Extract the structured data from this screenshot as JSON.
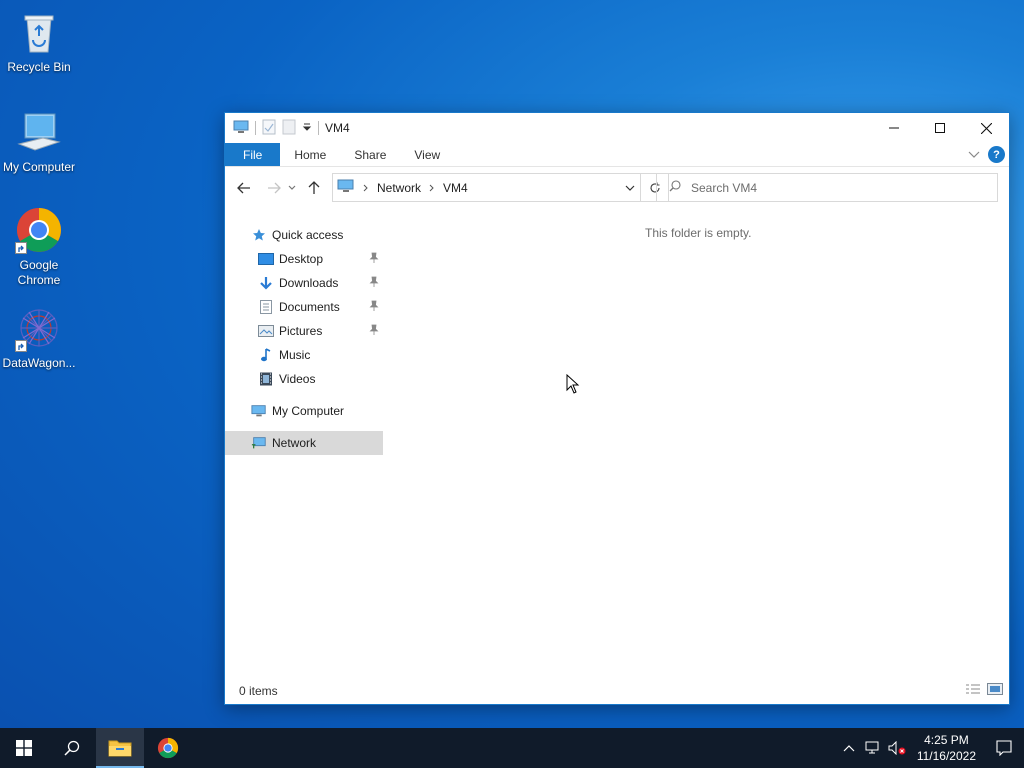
{
  "desktop": {
    "icons": [
      {
        "label": "Recycle Bin",
        "icon": "recycle-bin-icon"
      },
      {
        "label": "My Computer",
        "icon": "computer-icon"
      },
      {
        "label": "Google Chrome",
        "icon": "chrome-icon"
      },
      {
        "label": "DataWagon...",
        "icon": "datawagon-icon"
      }
    ]
  },
  "window": {
    "title": "VM4",
    "tabs": {
      "file": "File",
      "home": "Home",
      "share": "Share",
      "view": "View"
    },
    "help": "?",
    "address": {
      "parts": [
        "Network",
        "VM4"
      ]
    },
    "search": {
      "placeholder": "Search VM4"
    },
    "nav": {
      "quick_access": "Quick access",
      "desktop": "Desktop",
      "downloads": "Downloads",
      "documents": "Documents",
      "pictures": "Pictures",
      "music": "Music",
      "videos": "Videos",
      "my_computer": "My Computer",
      "network": "Network"
    },
    "empty_message": "This folder is empty.",
    "status": "0 items"
  },
  "taskbar": {
    "time": "4:25 PM",
    "date": "11/16/2022"
  },
  "colors": {
    "accent": "#1979ca",
    "taskbar": "#101b2a",
    "selected": "#d9d9d9"
  }
}
